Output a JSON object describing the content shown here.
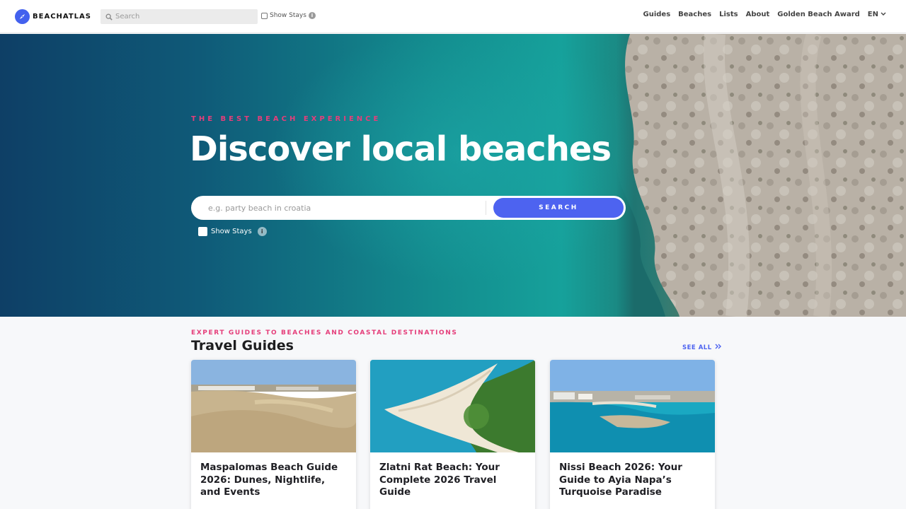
{
  "brand": {
    "name": "BEACHATLAS",
    "accent": "#4361ee",
    "pink": "#e53e7a"
  },
  "topbar": {
    "search_placeholder": "Search",
    "show_stays_label": "Show Stays",
    "info_glyph": "i",
    "nav": [
      "Guides",
      "Beaches",
      "Lists",
      "About",
      "Golden Beach Award"
    ],
    "language": "EN"
  },
  "hero": {
    "eyebrow": "THE BEST BEACH EXPERIENCE",
    "title": "Discover local beaches",
    "search_placeholder": "e.g. party beach in croatia",
    "search_button": "SEARCH",
    "show_stays_label": "Show Stays",
    "info_glyph": "i"
  },
  "guides": {
    "eyebrow": "EXPERT GUIDES TO BEACHES AND COASTAL DESTINATIONS",
    "title": "Travel Guides",
    "see_all": "SEE ALL",
    "cards": [
      {
        "title": "Maspalomas Beach Guide 2026: Dunes, Nightlife, and Events"
      },
      {
        "title": "Zlatni Rat Beach: Your Complete 2026 Travel Guide"
      },
      {
        "title": "Nissi Beach 2026: Your Guide to Ayia Napa’s Turquoise Paradise"
      }
    ]
  }
}
